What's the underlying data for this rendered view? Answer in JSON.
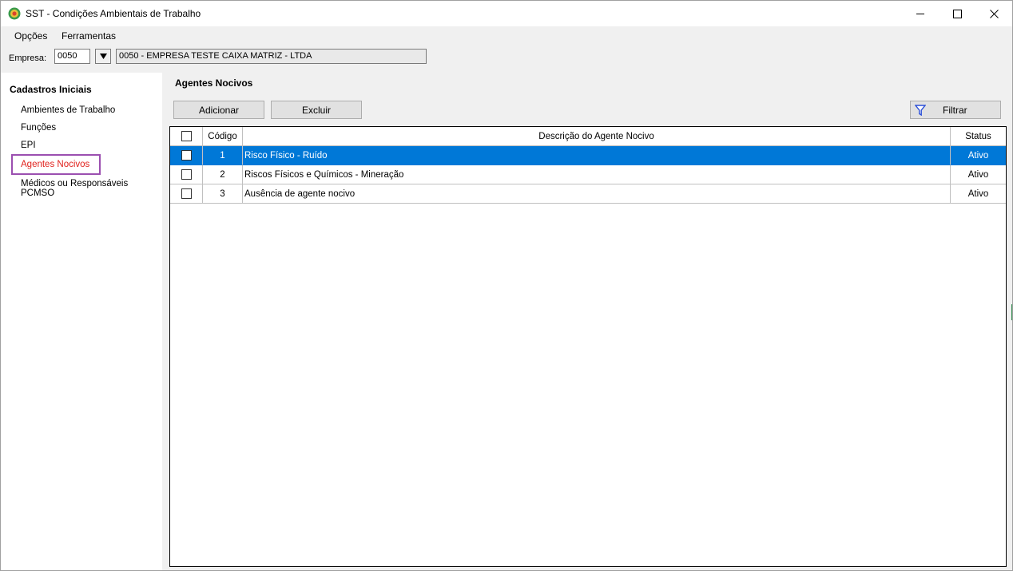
{
  "window": {
    "title": "SST - Condições Ambientais de Trabalho",
    "minimize": "—",
    "maximize": "☐",
    "close": "✕"
  },
  "menu": {
    "items": [
      {
        "label": "Opções"
      },
      {
        "label": "Ferramentas"
      }
    ]
  },
  "empresa": {
    "label": "Empresa:",
    "code": "0050",
    "dropdown_glyph": "▼",
    "name": "0050 - EMPRESA TESTE CAIXA MATRIZ -  LTDA"
  },
  "sidebar": {
    "title": "Cadastros Iniciais",
    "items": [
      {
        "label": "Ambientes de Trabalho"
      },
      {
        "label": "Funções"
      },
      {
        "label": "EPI"
      },
      {
        "label": "Agentes Nocivos"
      },
      {
        "label": "Médicos ou Responsáveis PCMSO"
      }
    ],
    "active_index": 3
  },
  "main": {
    "title": "Agentes Nocivos",
    "buttons": {
      "add": "Adicionar",
      "delete": "Excluir",
      "filter": "Filtrar"
    }
  },
  "table": {
    "columns": {
      "codigo": "Código",
      "descricao": "Descrição do Agente Nocivo",
      "status": "Status"
    },
    "rows": [
      {
        "codigo": "1",
        "descricao": "Risco Físico - Ruído",
        "status": "Ativo",
        "selected": true
      },
      {
        "codigo": "2",
        "descricao": "Riscos Físicos e Químicos - Mineração",
        "status": "Ativo",
        "selected": false
      },
      {
        "codigo": "3",
        "descricao": "Ausência de agente nocivo",
        "status": "Ativo",
        "selected": false
      }
    ]
  },
  "colors": {
    "selection": "#0078d7",
    "active_link": "#e0211c",
    "highlight_box": "#9b4fb0"
  }
}
